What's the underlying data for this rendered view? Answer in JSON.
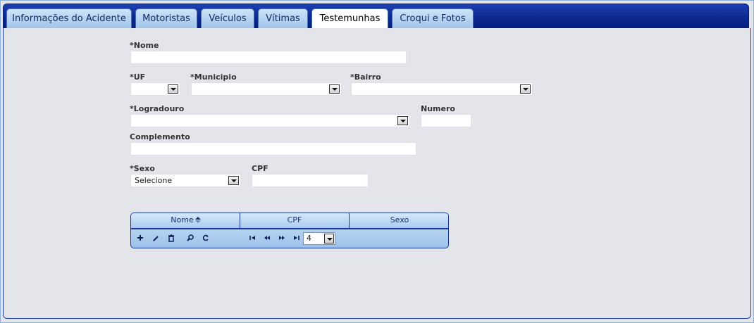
{
  "tabs": [
    {
      "label": "Informações do Acidente"
    },
    {
      "label": "Motoristas"
    },
    {
      "label": "Veículos"
    },
    {
      "label": "Vítimas"
    },
    {
      "label": "Testemunhas"
    },
    {
      "label": "Croqui e Fotos"
    }
  ],
  "active_tab": "Testemunhas",
  "form": {
    "nome_label": "*Nome",
    "uf_label": "*UF",
    "municipio_label": "*Municipio",
    "bairro_label": "*Bairro",
    "logradouro_label": "*Logradouro",
    "numero_label": "Numero",
    "complemento_label": "Complemento",
    "sexo_label": "*Sexo",
    "sexo_value": "Selecione",
    "cpf_label": "CPF"
  },
  "grid": {
    "columns": [
      "Nome",
      "CPF",
      "Sexo"
    ],
    "sorted_column": "Nome",
    "page_size": "4",
    "toolbar_icons": [
      "add-icon",
      "edit-icon",
      "delete-icon",
      "search-icon",
      "refresh-icon"
    ],
    "pager_icons": [
      "first-page-icon",
      "prev-page-icon",
      "next-page-icon",
      "last-page-icon"
    ]
  },
  "colors": {
    "tabbar": "#0b2890",
    "tab": "#9fc4eb",
    "panel": "#e4e5ea"
  }
}
